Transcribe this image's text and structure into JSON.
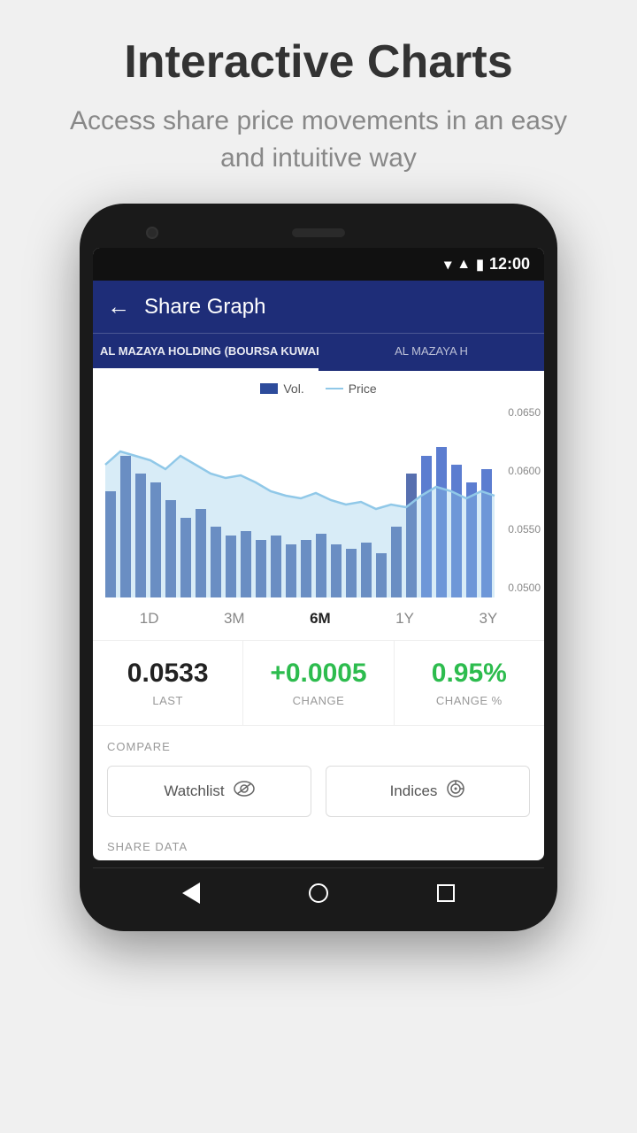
{
  "header": {
    "title": "Interactive Charts",
    "subtitle": "Access share price movements in an easy and intuitive way"
  },
  "statusBar": {
    "time": "12:00"
  },
  "appBar": {
    "title": "Share Graph",
    "backLabel": "←"
  },
  "tabs": [
    {
      "label": "AL MAZAYA HOLDING (BOURSA KUWAIT)",
      "active": true
    },
    {
      "label": "AL MAZAYA H",
      "active": false
    }
  ],
  "chart": {
    "legend": {
      "volLabel": "Vol.",
      "priceLabel": "Price"
    },
    "yAxis": [
      "0.0650",
      "0.0600",
      "0.0550",
      "0.0500"
    ],
    "periods": [
      "1D",
      "3M",
      "6M",
      "1Y",
      "3Y"
    ],
    "activePeriod": "6M"
  },
  "stats": [
    {
      "value": "0.0533",
      "label": "LAST",
      "positive": false
    },
    {
      "value": "+0.0005",
      "label": "CHANGE",
      "positive": true
    },
    {
      "value": "0.95%",
      "label": "CHANGE %",
      "positive": true
    }
  ],
  "compare": {
    "label": "COMPARE",
    "buttons": [
      {
        "label": "Watchlist",
        "icon": "👁"
      },
      {
        "label": "Indices",
        "icon": "◎"
      }
    ]
  },
  "shareData": {
    "label": "SHARE DATA"
  }
}
